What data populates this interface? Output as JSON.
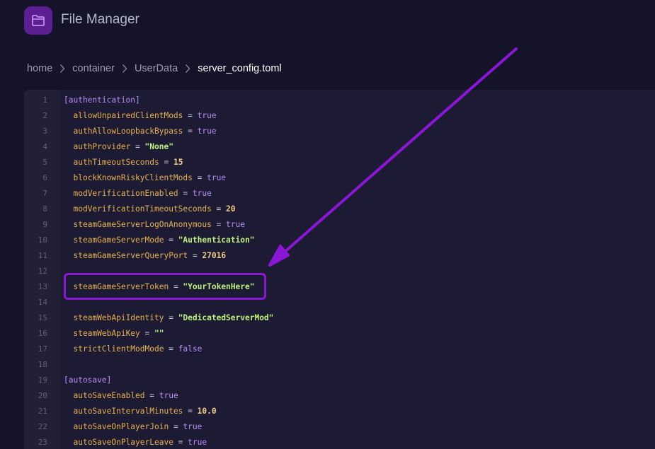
{
  "app": {
    "title": "File Manager",
    "icon": "folder-icon"
  },
  "breadcrumb": [
    "home",
    "container",
    "UserData",
    "server_config.toml"
  ],
  "colors": {
    "background": "#14132a",
    "editor": "#1d1b34",
    "accent": "#8a16d6",
    "key": "#e6b24f",
    "string": "#bff27d",
    "boolean": "#b88ef7",
    "number": "#f2cf86"
  },
  "editor": {
    "lines": [
      {
        "n": "1",
        "section": "[authentication]"
      },
      {
        "n": "2",
        "key": "allowUnpairedClientMods",
        "value": "true",
        "type": "bool"
      },
      {
        "n": "3",
        "key": "authAllowLoopbackBypass",
        "value": "true",
        "type": "bool"
      },
      {
        "n": "4",
        "key": "authProvider",
        "value": "\"None\"",
        "type": "str"
      },
      {
        "n": "5",
        "key": "authTimeoutSeconds",
        "value": "15",
        "type": "num"
      },
      {
        "n": "6",
        "key": "blockKnownRiskyClientMods",
        "value": "true",
        "type": "bool"
      },
      {
        "n": "7",
        "key": "modVerificationEnabled",
        "value": "true",
        "type": "bool"
      },
      {
        "n": "8",
        "key": "modVerificationTimeoutSeconds",
        "value": "20",
        "type": "num"
      },
      {
        "n": "9",
        "key": "steamGameServerLogOnAnonymous",
        "value": "true",
        "type": "bool"
      },
      {
        "n": "10",
        "key": "steamGameServerMode",
        "value": "\"Authentication\"",
        "type": "str"
      },
      {
        "n": "11",
        "key": "steamGameServerQueryPort",
        "value": "27016",
        "type": "num"
      },
      {
        "n": "12"
      },
      {
        "n": "13",
        "key": "steamGameServerToken",
        "value": "\"YourTokenHere\"",
        "type": "str",
        "highlighted": true
      },
      {
        "n": "14"
      },
      {
        "n": "15",
        "key": "steamWebApiIdentity",
        "value": "\"DedicatedServerMod\"",
        "type": "str"
      },
      {
        "n": "16",
        "key": "steamWebApiKey",
        "value": "\"\"",
        "type": "str"
      },
      {
        "n": "17",
        "key": "strictClientModMode",
        "value": "false",
        "type": "bool"
      },
      {
        "n": "18"
      },
      {
        "n": "19",
        "section": "[autosave]"
      },
      {
        "n": "20",
        "key": "autoSaveEnabled",
        "value": "true",
        "type": "bool"
      },
      {
        "n": "21",
        "key": "autoSaveIntervalMinutes",
        "value": "10.0",
        "type": "num"
      },
      {
        "n": "22",
        "key": "autoSaveOnPlayerJoin",
        "value": "true",
        "type": "bool"
      },
      {
        "n": "23",
        "key": "autoSaveOnPlayerLeave",
        "value": "true",
        "type": "bool"
      }
    ]
  }
}
